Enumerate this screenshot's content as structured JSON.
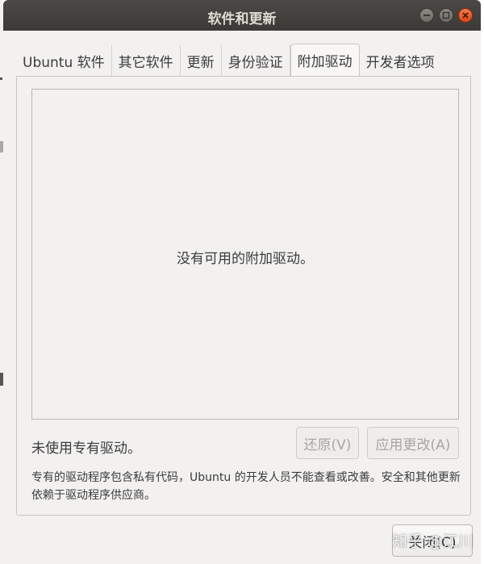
{
  "window": {
    "title": "软件和更新"
  },
  "tabs": [
    {
      "label": "Ubuntu 软件",
      "active": false
    },
    {
      "label": "其它软件",
      "active": false
    },
    {
      "label": "更新",
      "active": false
    },
    {
      "label": "身份验证",
      "active": false
    },
    {
      "label": "附加驱动",
      "active": true
    },
    {
      "label": "开发者选项",
      "active": false
    }
  ],
  "drivers": {
    "empty_message": "没有可用的附加驱动。",
    "status": "未使用专有驱动。",
    "revert_label": "还原(V)",
    "apply_label": "应用更改(A)",
    "note": "专有的驱动程序包含私有代码，Ubuntu 的开发人员不能查看或改善。安全和其他更新依赖于驱动程序供应商。"
  },
  "footer": {
    "close_label": "关闭(C)"
  },
  "watermark": {
    "text": "知乎 @江川"
  },
  "colors": {
    "titlebar": "#3b3a36",
    "window_bg": "#f2f1f0",
    "close_button": "#de4815"
  }
}
